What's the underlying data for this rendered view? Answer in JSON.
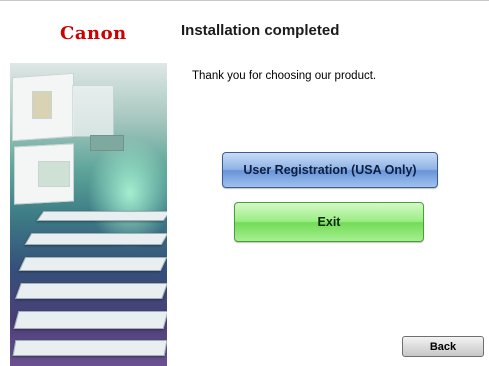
{
  "brand": {
    "logo_text": "Canon",
    "logo_color": "#cc0000"
  },
  "header": {
    "title": "Installation completed"
  },
  "main": {
    "message": "Thank you for choosing our product.",
    "buttons": {
      "registration_label": "User Registration (USA Only)",
      "exit_label": "Exit",
      "back_label": "Back"
    }
  },
  "colors": {
    "registration_button": "#8fb3e6",
    "exit_button": "#9bed84",
    "back_button": "#dcdcdc"
  }
}
